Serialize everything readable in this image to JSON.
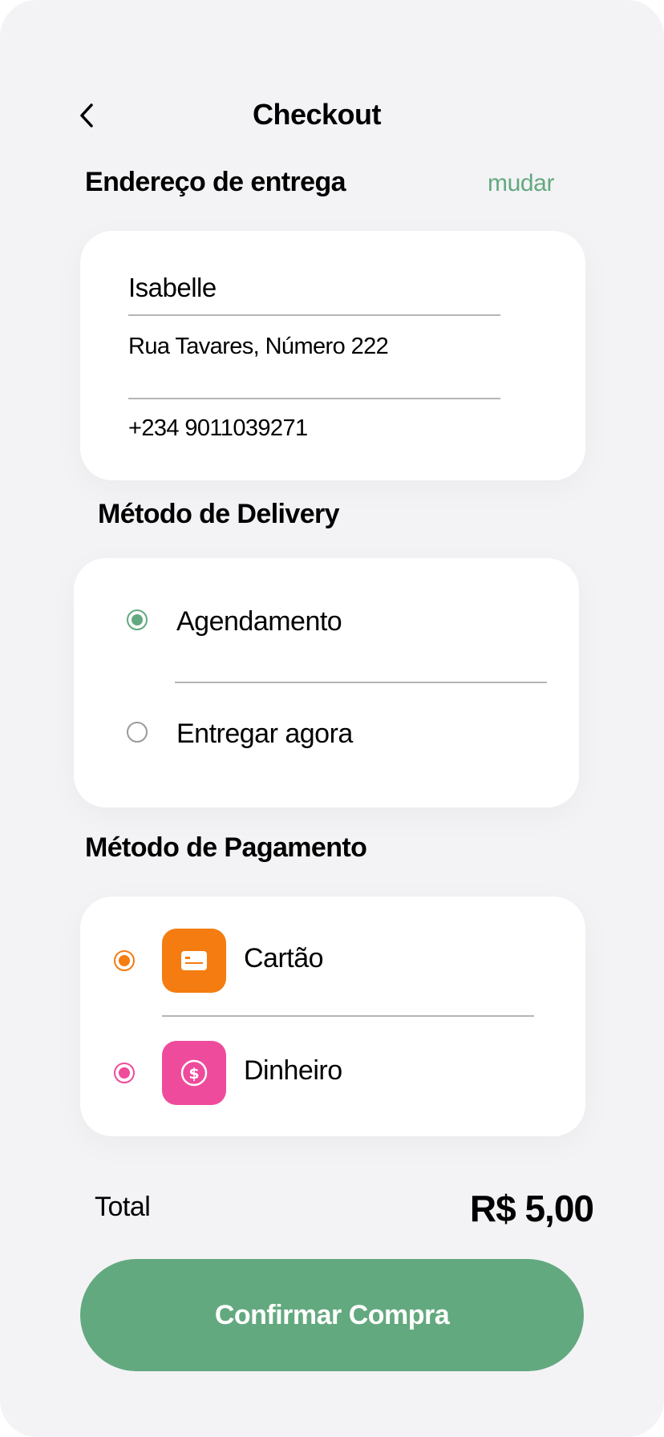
{
  "header": {
    "title": "Checkout"
  },
  "address": {
    "section_title": "Endereço de entrega",
    "change_label": "mudar",
    "name": "Isabelle",
    "street": "Rua Tavares, Número 222",
    "phone": "+234 9011039271"
  },
  "delivery": {
    "section_title": "Método de Delivery",
    "options": [
      {
        "label": "Agendamento",
        "selected": true
      },
      {
        "label": "Entregar agora",
        "selected": false
      }
    ],
    "accent_color": "#63a97f"
  },
  "payment": {
    "section_title": "Método de Pagamento",
    "options": [
      {
        "label": "Cartão",
        "icon": "credit-card-icon",
        "color": "#f57c10",
        "selected": true
      },
      {
        "label": "Dinheiro",
        "icon": "dollar-coin-icon",
        "color": "#ef4b9c",
        "selected": true
      }
    ]
  },
  "total": {
    "label": "Total",
    "value": "R$ 5,00"
  },
  "confirm": {
    "label": "Confirmar Compra",
    "color": "#63a97f"
  }
}
